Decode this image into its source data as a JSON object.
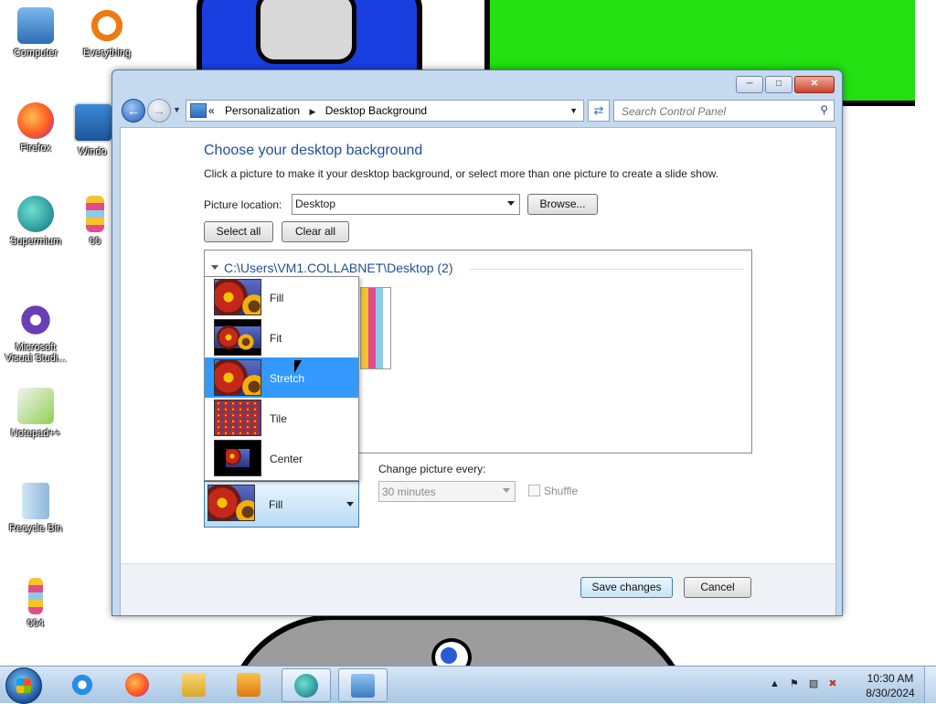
{
  "desktop": {
    "icons": [
      {
        "label": "Computer"
      },
      {
        "label": "Everything"
      },
      {
        "label": "Firefox"
      },
      {
        "label": "Windo"
      },
      {
        "label": "Supermium"
      },
      {
        "label": "00"
      },
      {
        "label": "Microsoft Visual Studi..."
      },
      {
        "label": "Notepad++"
      },
      {
        "label": "Recycle Bin"
      },
      {
        "label": "004"
      }
    ]
  },
  "window": {
    "address": {
      "overflow": "«",
      "crumbs": [
        "Personalization",
        "Desktop Background"
      ]
    },
    "search_placeholder": "Search Control Panel",
    "heading": "Choose your desktop background",
    "subtext": "Click a picture to make it your desktop background, or select more than one picture to create a slide show.",
    "picture_location_label": "Picture location:",
    "picture_location_value": "Desktop",
    "browse_label": "Browse...",
    "select_all_label": "Select all",
    "clear_all_label": "Clear all",
    "folder_title": "C:\\Users\\VM1.COLLABNET\\Desktop (2)",
    "picture_position": {
      "selected": "Fill",
      "highlighted": "Stretch",
      "options": [
        "Fill",
        "Fit",
        "Stretch",
        "Tile",
        "Center"
      ]
    },
    "change_picture_label": "Change picture every:",
    "interval_value": "30 minutes",
    "shuffle_label": "Shuffle",
    "save_label": "Save changes",
    "cancel_label": "Cancel"
  },
  "taskbar": {
    "clock_time": "10:30 AM",
    "clock_date": "8/30/2024"
  },
  "colors": {
    "heading": "#1f4e9a",
    "selection": "#3399ff",
    "window_frame": "#c5d9ef"
  }
}
